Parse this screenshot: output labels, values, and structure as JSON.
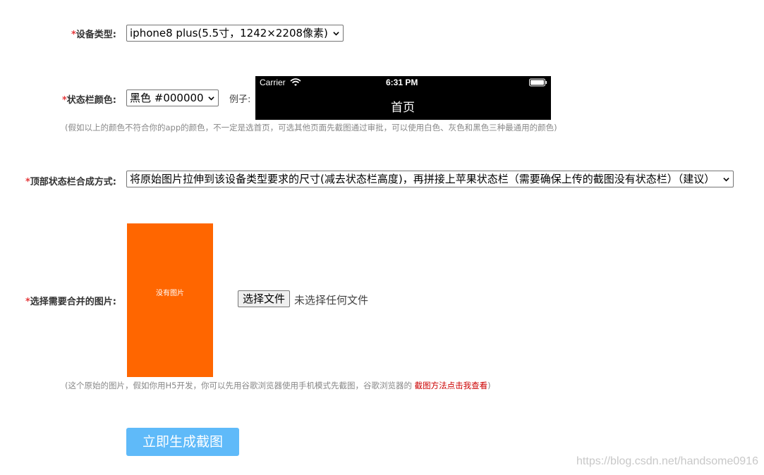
{
  "device": {
    "label": "设备类型:",
    "required_mark": "*",
    "selected": "iphone8 plus(5.5寸，1242×2208像素)"
  },
  "statusbar_color": {
    "label": "状态栏颜色:",
    "required_mark": "*",
    "selected": "黑色 #000000",
    "example_label": "例子:",
    "preview": {
      "carrier": "Carrier",
      "time": "6:31 PM",
      "title": "首页",
      "wifi_icon": "wifi-icon",
      "battery_icon": "battery-icon"
    },
    "hint": "(假如以上的颜色不符合你的app的颜色，不一定是选首页，可选其他页面先截图通过审批，可以使用白色、灰色和黑色三种最通用的颜色)"
  },
  "compose_mode": {
    "label": "顶部状态栏合成方式:",
    "required_mark": "*",
    "selected": "将原始图片拉伸到该设备类型要求的尺寸(减去状态栏高度)，再拼接上苹果状态栏（需要确保上传的截图没有状态栏）（建议）"
  },
  "image_select": {
    "label": "选择需要合并的图片:",
    "required_mark": "*",
    "placeholder_text": "没有图片",
    "placeholder_color": "#ff6600",
    "file_button": "选择文件",
    "file_status": "未选择任何文件",
    "hint_prefix": "(这个原始的图片，假如你用H5开发，你可以先用谷歌浏览器使用手机模式先截图，谷歌浏览器的 ",
    "hint_link": "截图方法点击我查看",
    "hint_suffix": ")"
  },
  "submit": {
    "label": "立即生成截图",
    "color": "#5fbaf9"
  },
  "watermark": "https://blog.csdn.net/handsome0916"
}
